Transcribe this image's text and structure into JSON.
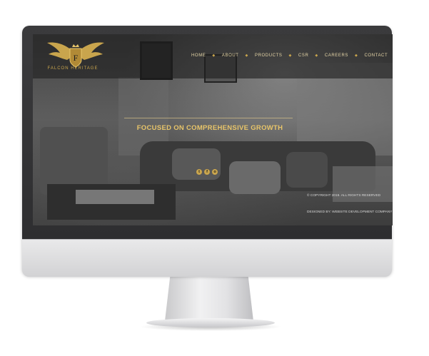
{
  "site": {
    "logo_text": "FALCON HERITAGE",
    "nav": [
      {
        "label": "HOME"
      },
      {
        "label": "ABOUT"
      },
      {
        "label": "PRODUCTS"
      },
      {
        "label": "CSR"
      },
      {
        "label": "CAREERS"
      },
      {
        "label": "CONTACT"
      }
    ],
    "hero_title": "FOCUSED ON COMPREHENSIVE GROWTH",
    "social": [
      {
        "icon": "twitter-icon",
        "glyph": "t"
      },
      {
        "icon": "facebook-icon",
        "glyph": "f"
      },
      {
        "icon": "instagram-icon",
        "glyph": "o"
      }
    ],
    "footer_line1": "© COPYRIGHT 2019. ALL RIGHTS RESERVED",
    "footer_line2": "DESIGNED BY: WEBSITE DEVELOPMENT COMPANY"
  },
  "colors": {
    "accent_gold": "#c9a54d",
    "title_gold": "#e8c56a"
  }
}
